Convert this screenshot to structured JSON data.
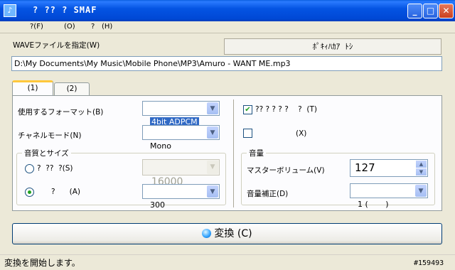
{
  "window": {
    "title": "? ?? ? SMAF",
    "minimize": "_",
    "maximize": "□",
    "close": "✕"
  },
  "menu": {
    "file": "?(F)",
    "options": "(O)",
    "help_prefix": "?",
    "help": "(H)"
  },
  "wave": {
    "label": "WAVEファイルを指定(W)",
    "browse_label": "ﾎﾟｷｨﾊｶｱ  ﾄｼ",
    "path": "D:\\My Documents\\My Music\\Mobile Phone\\MP3\\Amuro - WANT ME.mp3"
  },
  "tabs": [
    {
      "label": "(1)"
    },
    {
      "label": "(2)"
    }
  ],
  "format": {
    "label": "使用するフォーマット(B)",
    "value": "4bit ADPCM"
  },
  "channel": {
    "label": "チャネルモード(N)",
    "value": "Mono"
  },
  "quality": {
    "title": "音質とサイズ",
    "sampling_label": "?  ??  ?(S)",
    "sampling_value": "16000",
    "size_label": "?      (A)",
    "size_value": "300"
  },
  "checks": {
    "first_label": "?? ? ? ? ?    ?  (T)",
    "first_checked": true,
    "second_label": "(X)",
    "second_checked": false
  },
  "volume": {
    "title": "音量",
    "master_label": "マスターボリューム(V)",
    "master_value": "127",
    "correction_label": "音量補正(D)",
    "correction_value": "1 (       )"
  },
  "convert_button": "変換 (C)",
  "status": "変換を開始します。",
  "watermark": "#159493"
}
